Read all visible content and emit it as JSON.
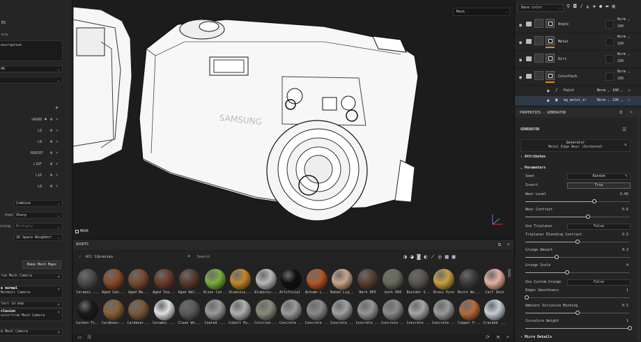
{
  "left_panel": {
    "title_fragment": "ES",
    "label_fragment": "era",
    "description_value": "escription",
    "select1": "96",
    "select2": "",
    "bake_rows": [
      {
        "format": "sRGB8"
      },
      {
        "format": "L8"
      },
      {
        "format": "L8"
      },
      {
        "format": "RGB16F"
      },
      {
        "format": "L16F"
      },
      {
        "format": "L16"
      },
      {
        "format": "L8"
      }
    ],
    "combine_select": "Combine",
    "method_label": "thod",
    "method_value": "Sharp",
    "multiply_label": "ining",
    "multiply_value": "Multiply",
    "neighbor_value": "2D Space Neighbor",
    "bake_button": "Bake Mesh Maps",
    "maps": [
      {
        "line1": "rom Mesh Camera",
        "line2": ""
      },
      {
        "line1": "e normal",
        "line2": "Normals Camera"
      },
      {
        "line1": "lect id map",
        "line2": ""
      },
      {
        "line1": "clusion",
        "line2": "usio~from Mesh Camera"
      },
      {
        "line1": "m Mesh Camera",
        "line2": ""
      }
    ]
  },
  "viewport": {
    "dropdown": "Mask",
    "mask_label": "MASK"
  },
  "assets": {
    "title": "ASSETS",
    "breadcrumb": "All libraries",
    "search_placeholder": "Search",
    "row1": [
      {
        "name": "Ceramic ...",
        "color": "#4a4a4a"
      },
      {
        "name": "Aged Ced...",
        "color": "#8a4a2a"
      },
      {
        "name": "Aged Ma...",
        "color": "#7a4a30"
      },
      {
        "name": "Aged Tea...",
        "color": "#6a3a28"
      },
      {
        "name": "Aged Wal...",
        "color": "#5a3a2a"
      },
      {
        "name": "Alien Cat...",
        "color": "#7cae3c"
      },
      {
        "name": "Aluminiu...",
        "color": "#c0882a"
      },
      {
        "name": "Aluminiu...",
        "color": "#b8b8b8"
      },
      {
        "name": "Artificial ...",
        "color": "#101010"
      },
      {
        "name": "Autumn L...",
        "color": "#b8562a"
      },
      {
        "name": "Baked Lig...",
        "color": "#caa58a"
      },
      {
        "name": "Bark 003",
        "color": "#5a4030"
      },
      {
        "name": "bark 004",
        "color": "#6a6a5a"
      },
      {
        "name": "Boulder S...",
        "color": "#5a5550"
      },
      {
        "name": "Brass Pure",
        "color": "#c8a040"
      },
      {
        "name": "Burnt Wo...",
        "color": "#3a3a3a"
      },
      {
        "name": "Calf Skin",
        "color": "#e8b0a0"
      }
    ],
    "row2": [
      {
        "name": "Carbon Fi...",
        "color": "#1a1a1a"
      },
      {
        "name": "Cardboar...",
        "color": "#8a6038"
      },
      {
        "name": "Cardboar...",
        "color": "#7a5a3a"
      },
      {
        "name": "Ceramic ...",
        "color": "#e0e0e0"
      },
      {
        "name": "Clean Wo...",
        "color": "#5a5a5a"
      },
      {
        "name": "Coated ...",
        "color": "#9a9a9a"
      },
      {
        "name": "Cobalt Pu...",
        "color": "#b0b0b0"
      },
      {
        "name": "Colorzat...",
        "color": "#8a8a7a"
      },
      {
        "name": "Concrete ...",
        "color": "#9a9a9a"
      },
      {
        "name": "Concrete ...",
        "color": "#8a8a8a"
      },
      {
        "name": "Concrete ...",
        "color": "#a0a0a0"
      },
      {
        "name": "Concrete ...",
        "color": "#959595"
      },
      {
        "name": "Concrete ...",
        "color": "#8a8a8a"
      },
      {
        "name": "Concrete ...",
        "color": "#a5a5a5"
      },
      {
        "name": "Concrete ...",
        "color": "#999999"
      },
      {
        "name": "Copper P...",
        "color": "#b86a3a"
      },
      {
        "name": "Cracked ...",
        "color": "#c8ccd8"
      }
    ]
  },
  "layers": {
    "channel_select": "Base color",
    "items": [
      {
        "name": "Angle",
        "blend": "Norm",
        "opacity": "100",
        "folder": true,
        "orange": false
      },
      {
        "name": "Metal",
        "blend": "Norm",
        "opacity": "100",
        "folder": true,
        "orange": true
      },
      {
        "name": "Dirt",
        "blend": "Norm",
        "opacity": "100",
        "folder": true,
        "orange": false
      },
      {
        "name": "ColorPack",
        "blend": "Norm",
        "opacity": "100",
        "folder": true,
        "orange": true
      }
    ],
    "subs": [
      {
        "name": "Paint",
        "blend": "Norm",
        "opacity": "100"
      },
      {
        "name": "mg_metal_e~",
        "blend": "Norm",
        "opacity": "100"
      }
    ]
  },
  "properties": {
    "title": "PROPERTIES - GENERATOR",
    "section": "GENERATOR",
    "generator_name": "Generator",
    "generator_sub": "Metal Edge Wear (Outdated)",
    "attributes": "Attributes",
    "parameters": "Parameters",
    "seed_label": "Seed",
    "seed_value": "Random",
    "invert_label": "Invert",
    "invert_value": "True",
    "wear_level_label": "Wear Level",
    "wear_level_value": "0.66",
    "wear_contrast_label": "Wear Contrast",
    "wear_contrast_value": "0.6",
    "use_triplanar_label": "Use Triplanar",
    "use_triplanar_value": "False",
    "triplanar_blend_label": "Triplanar Blending Contrast",
    "triplanar_blend_value": "0.5",
    "grunge_amount_label": "Grunge Amount",
    "grunge_amount_value": "0.3",
    "grunge_scale_label": "Grunge Scale",
    "grunge_scale_value": "4",
    "use_custom_grunge_label": "Use Custom Grunge",
    "use_custom_grunge_value": "False",
    "edges_smoothness_label": "Edges Smoothness",
    "edges_smoothness_value": "1",
    "ao_masking_label": "Ambient Occlusion Masking",
    "ao_masking_value": "0.5",
    "curvature_weight_label": "Curvature Weight",
    "curvature_weight_value": "1",
    "micro_details": "Micro Details"
  }
}
